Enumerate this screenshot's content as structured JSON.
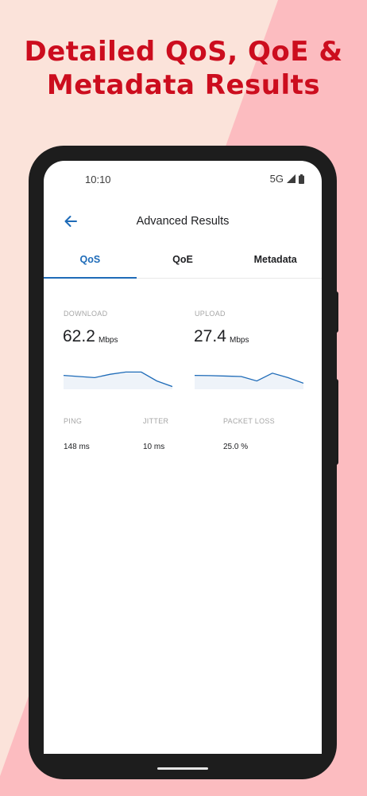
{
  "headline": {
    "line1": "Detailed QoS, QoE &",
    "line2": "Metadata Results"
  },
  "colors": {
    "headline": "#cc0d1e",
    "background_light": "#fbe3da",
    "background_pink": "#fcbcc0",
    "accent_blue": "#1e6bb8"
  },
  "status_bar": {
    "time": "10:10",
    "network": "5G",
    "icons": [
      "cellular-signal-icon",
      "battery-icon"
    ]
  },
  "app_bar": {
    "back_icon": "arrow-left-icon",
    "title": "Advanced Results"
  },
  "tabs": [
    {
      "label": "QoS",
      "active": true
    },
    {
      "label": "QoE",
      "active": false
    },
    {
      "label": "Metadata",
      "active": false
    }
  ],
  "download": {
    "label": "DOWNLOAD",
    "value": "62.2",
    "unit": "Mbps",
    "trend": [
      0.55,
      0.5,
      0.45,
      0.6,
      0.7,
      0.7,
      0.3,
      0.05
    ]
  },
  "upload": {
    "label": "UPLOAD",
    "value": "27.4",
    "unit": "Mbps",
    "trend": [
      0.55,
      0.54,
      0.52,
      0.5,
      0.3,
      0.65,
      0.45,
      0.2
    ]
  },
  "ping": {
    "label": "PING",
    "value": "148 ms"
  },
  "jitter": {
    "label": "JITTER",
    "value": "10 ms"
  },
  "packet_loss": {
    "label": "PACKET LOSS",
    "value": "25.0 %"
  }
}
